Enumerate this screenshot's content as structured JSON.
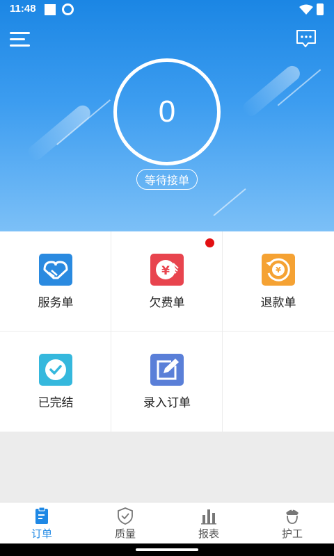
{
  "status_bar": {
    "time": "11:48"
  },
  "header": {
    "counter_value": "0",
    "status_label": "等待接单"
  },
  "grid": {
    "items": [
      {
        "label": "服务单",
        "icon": "handshake-icon",
        "color": "#2a8ae0"
      },
      {
        "label": "欠费单",
        "icon": "yuan-icon",
        "color": "#e8444e",
        "has_badge": true
      },
      {
        "label": "退款单",
        "icon": "refund-icon",
        "color": "#f5a233"
      },
      {
        "label": "已完结",
        "icon": "check-icon",
        "color": "#35b8dd"
      },
      {
        "label": "录入订单",
        "icon": "edit-icon",
        "color": "#5a7fd8"
      }
    ]
  },
  "bottom_nav": {
    "items": [
      {
        "label": "订单",
        "icon": "clipboard-icon",
        "active": true
      },
      {
        "label": "质量",
        "icon": "shield-check-icon"
      },
      {
        "label": "报表",
        "icon": "bar-chart-icon"
      },
      {
        "label": "护工",
        "icon": "nurse-icon"
      }
    ]
  },
  "colors": {
    "primary": "#1e88e5",
    "badge": "#e20f12"
  }
}
